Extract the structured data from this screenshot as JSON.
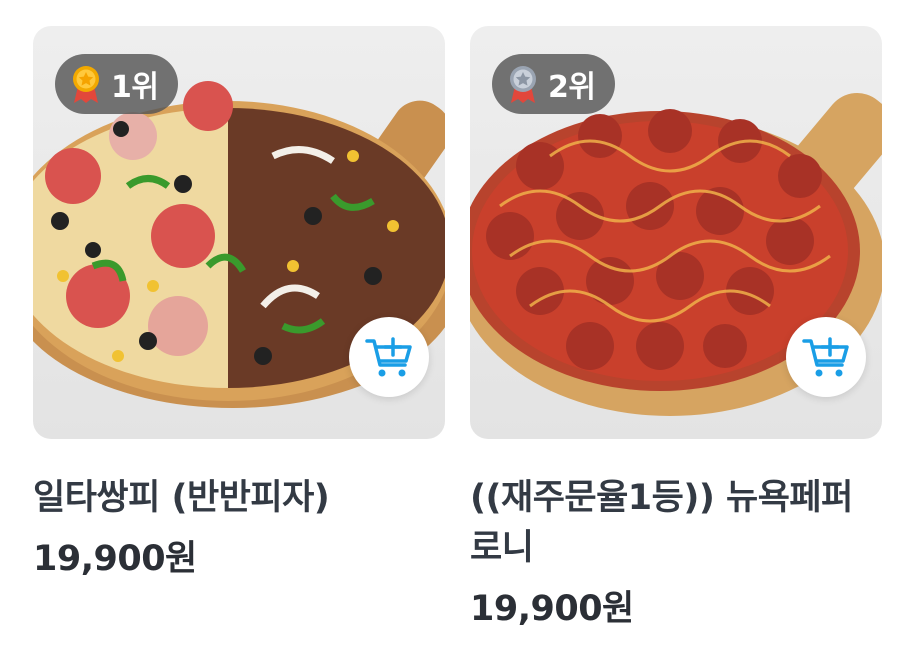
{
  "products": [
    {
      "rank_label": "1위",
      "medal": "gold-medal-icon",
      "name": "일타쌍피 (반반피자)",
      "price": "19,900원"
    },
    {
      "rank_label": "2위",
      "medal": "silver-medal-icon",
      "name": "((재주문율1등)) 뉴욕페퍼로니",
      "price": "19,900원"
    }
  ],
  "icons": {
    "cart": "add-to-cart-icon"
  },
  "colors": {
    "accent": "#1a9ee6",
    "badge_bg": "#565656",
    "text": "#333a44"
  }
}
